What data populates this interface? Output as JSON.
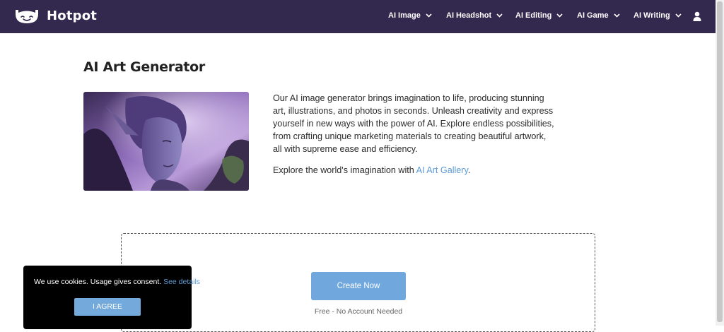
{
  "brand": {
    "name": "Hotpot"
  },
  "nav": {
    "items": [
      {
        "label": "AI Image"
      },
      {
        "label": "AI Headshot"
      },
      {
        "label": "AI Editing"
      },
      {
        "label": "AI Game"
      },
      {
        "label": "AI Writing"
      }
    ],
    "user_icon": "user-icon",
    "chevron_icon": "chevron-down-icon"
  },
  "main": {
    "title": "AI Art Generator",
    "hero_image_alt": "fantasy-elf-portrait",
    "description": "Our AI image generator brings imagination to life, producing stunning art, illustrations, and photos in seconds. Unleash creativity and express yourself in new ways with the power of AI. Explore endless possibilities, from crafting unique marketing materials to creating beautiful artwork, all with supreme ease and efficiency.",
    "explore_prefix": "Explore the world's imagination with ",
    "explore_link": "AI Art Gallery",
    "explore_suffix": "."
  },
  "create": {
    "button_label": "Create Now",
    "subtext": "Free - No Account Needed"
  },
  "cookie": {
    "text": "We use cookies. Usage gives consent. ",
    "link": "See details",
    "suffix": ".",
    "button_label": "I AGREE"
  },
  "colors": {
    "navbar": "#33284d",
    "accent": "#70a8dd",
    "link": "#5b9bd5",
    "cookie_bg": "#000000"
  }
}
